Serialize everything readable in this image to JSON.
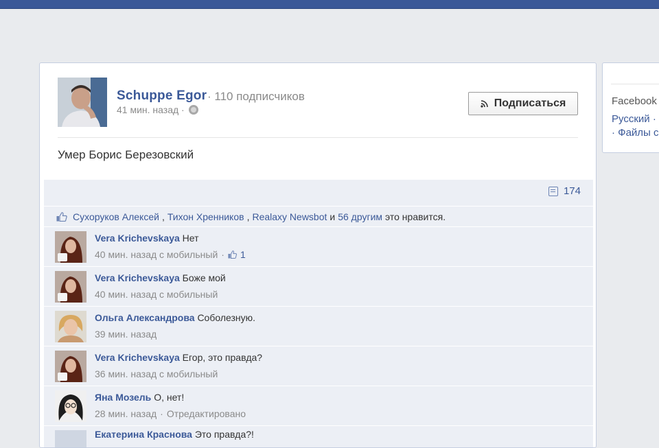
{
  "post": {
    "author": "Schuppe Egor",
    "subscribers": "· 110 подписчиков",
    "time": "41 мин. назад ·",
    "subscribe_label": "Подписаться",
    "text": "Умер Борис Березовский",
    "comment_count": "174"
  },
  "likes": {
    "names": [
      {
        "text": "Сухоруков Алексей",
        "sep": ","
      },
      {
        "text": "Тихон Хренников",
        "sep": ","
      },
      {
        "text": "Realaxy Newsbot",
        "sep": " и"
      },
      {
        "text": "56 другим",
        "sep": ""
      }
    ],
    "suffix": "это нравится."
  },
  "comments": [
    {
      "author": "Vera Krichevskaya",
      "text": "Нет",
      "meta": "40 мин. назад с мобильный",
      "dot": "·",
      "likes": "1"
    },
    {
      "author": "Vera Krichevskaya",
      "text": "Боже мой",
      "meta": "40 мин. назад с мобильный"
    },
    {
      "author": "Ольга Александрова",
      "text": "Соболезную.",
      "meta": "39 мин. назад"
    },
    {
      "author": "Vera Krichevskaya",
      "text": "Егор, это правда?",
      "meta": "36 мин. назад с мобильный"
    },
    {
      "author": "Яна Мозель",
      "text": "О, нет!",
      "meta": "28 мин. назад",
      "dot": "·",
      "extra": "Отредактировано"
    },
    {
      "author": "Екатерина Краснова",
      "text": "Это правда?!",
      "meta": ""
    }
  ],
  "sidebar": {
    "line1": "Facebook",
    "line2": "Русский ·",
    "line3": "· Файлы с"
  },
  "colors": {
    "brand": "#3b5998",
    "muted": "#8a8a8a",
    "comment_bg": "#eceff5"
  }
}
